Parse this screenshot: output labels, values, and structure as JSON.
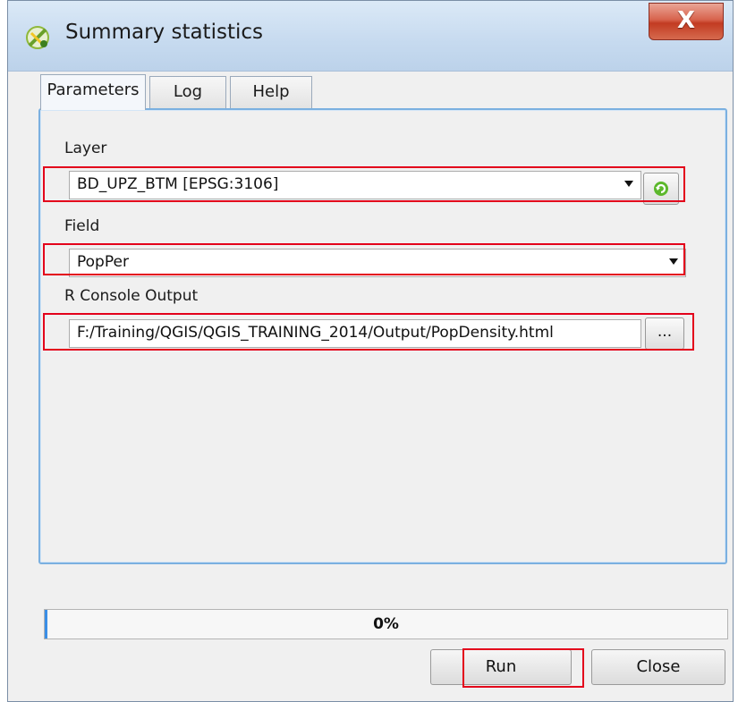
{
  "window": {
    "title": "Summary statistics",
    "close_glyph": "X"
  },
  "tabs": [
    {
      "label": "Parameters",
      "active": true
    },
    {
      "label": "Log",
      "active": false
    },
    {
      "label": "Help",
      "active": false
    }
  ],
  "params": {
    "layer_label": "Layer",
    "layer_value": "BD_UPZ_BTM [EPSG:3106]",
    "field_label": "Field",
    "field_value": "PopPer",
    "output_label": "R Console Output",
    "output_value": "F:/Training/QGIS/QGIS_TRAINING_2014/Output/PopDensity.html",
    "browse_label": "..."
  },
  "icons": {
    "app": "qgis-icon",
    "refresh": "refresh-icon",
    "dropdown": "chevron-down-icon"
  },
  "progress": {
    "text": "0%",
    "value": 0
  },
  "buttons": {
    "run": "Run",
    "close": "Close"
  },
  "colors": {
    "highlight": "#e3001b",
    "panel_border": "#7bb0e0"
  }
}
